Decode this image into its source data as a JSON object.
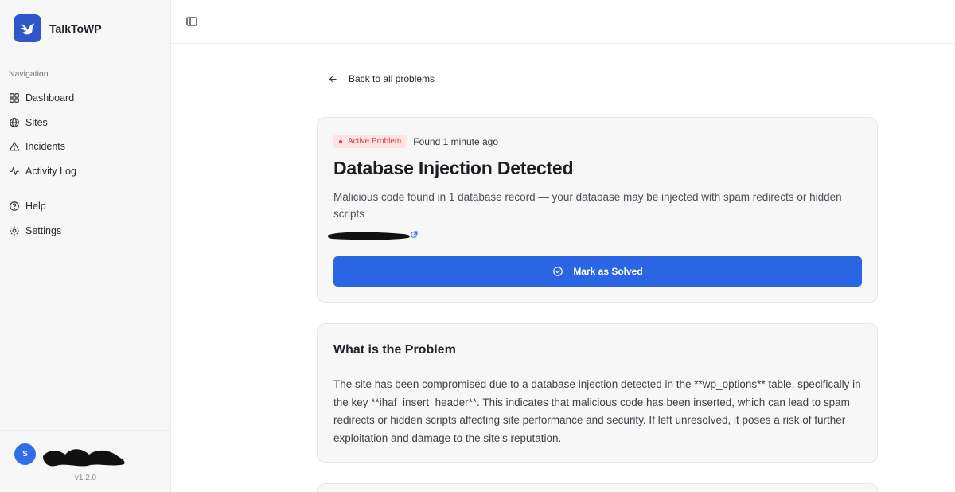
{
  "app": {
    "name": "TalkToWP",
    "version": "v1.2.0"
  },
  "sidebar": {
    "section_label": "Navigation",
    "items": [
      {
        "label": "Dashboard",
        "icon": "dashboard-icon"
      },
      {
        "label": "Sites",
        "icon": "globe-icon"
      },
      {
        "label": "Incidents",
        "icon": "warning-icon"
      },
      {
        "label": "Activity Log",
        "icon": "activity-icon"
      }
    ],
    "secondary_items": [
      {
        "label": "Help",
        "icon": "help-icon"
      },
      {
        "label": "Settings",
        "icon": "gear-icon"
      }
    ],
    "user": {
      "initial": "S"
    }
  },
  "main": {
    "back_label": "Back to all problems",
    "problem": {
      "badge": "Active Problem",
      "found": "Found 1 minute ago",
      "title": "Database Injection Detected",
      "description": "Malicious code found in 1 database record — your database may be injected with spam redirects or hidden scripts",
      "button_label": "Mark as Solved"
    },
    "details": {
      "title": "What is the Problem",
      "body": "The site has been compromised due to a database injection detected in the **wp_options** table, specifically in the key **ihaf_insert_header**. This indicates that malicious code has been inserted, which can lead to spam redirects or hidden scripts affecting site performance and security. If left unresolved, it poses a risk of further exploitation and damage to the site's reputation."
    }
  },
  "colors": {
    "accent": "#2a66e3",
    "danger": "#e23b3b",
    "badge_bg": "#fde3e3",
    "sidebar_bg": "#f7f7f8"
  }
}
